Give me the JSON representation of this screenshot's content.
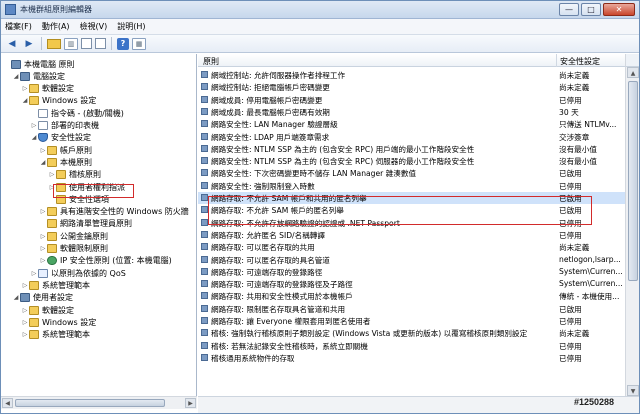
{
  "window": {
    "title": "本機群組原則編輯器",
    "min": "—",
    "max": "□",
    "close": "✕"
  },
  "menu": [
    "檔案(F)",
    "動作(A)",
    "檢視(V)",
    "說明(H)"
  ],
  "toolbar": [
    "back-icon",
    "forward-icon",
    "up-folder-icon",
    "show-tree-icon",
    "properties-icon",
    "export-icon",
    "help-icon",
    "view-icon"
  ],
  "tree": [
    {
      "label": "本機電腦 原則",
      "level": 0,
      "expander": "",
      "icon": "computer"
    },
    {
      "label": "電腦設定",
      "level": 1,
      "expander": "◢",
      "icon": "computer"
    },
    {
      "label": "軟體設定",
      "level": 2,
      "expander": "▷",
      "icon": "folder"
    },
    {
      "label": "Windows 設定",
      "level": 2,
      "expander": "◢",
      "icon": "folder"
    },
    {
      "label": "指令碼 - (啟動/關機)",
      "level": 3,
      "expander": "",
      "icon": "doc"
    },
    {
      "label": "部署的印表機",
      "level": 3,
      "expander": "▷",
      "icon": "doc"
    },
    {
      "label": "安全性設定",
      "level": 3,
      "expander": "◢",
      "icon": "shield"
    },
    {
      "label": "帳戶原則",
      "level": 4,
      "expander": "▷",
      "icon": "folder"
    },
    {
      "label": "本機原則",
      "level": 4,
      "expander": "◢",
      "icon": "folder"
    },
    {
      "label": "稽核原則",
      "level": 5,
      "expander": "▷",
      "icon": "folder"
    },
    {
      "label": "使用者權利指派",
      "level": 5,
      "expander": "▷",
      "icon": "folder"
    },
    {
      "label": "安全性選項",
      "level": 5,
      "expander": "",
      "icon": "folder"
    },
    {
      "label": "具有進階安全性的 Windows 防火牆",
      "level": 4,
      "expander": "▷",
      "icon": "folder"
    },
    {
      "label": "網路清單管理員原則",
      "level": 4,
      "expander": "",
      "icon": "folder"
    },
    {
      "label": "公開金鑰原則",
      "level": 4,
      "expander": "▷",
      "icon": "folder"
    },
    {
      "label": "軟體限制原則",
      "level": 4,
      "expander": "▷",
      "icon": "folder"
    },
    {
      "label": "IP 安全性原則 (位置: 本機電腦)",
      "level": 4,
      "expander": "▷",
      "icon": "net"
    },
    {
      "label": "以原則為依據的 QoS",
      "level": 3,
      "expander": "▷",
      "icon": "chart"
    },
    {
      "label": "系統管理範本",
      "level": 2,
      "expander": "▷",
      "icon": "folder"
    },
    {
      "label": "使用者設定",
      "level": 1,
      "expander": "◢",
      "icon": "computer"
    },
    {
      "label": "軟體設定",
      "level": 2,
      "expander": "▷",
      "icon": "folder"
    },
    {
      "label": "Windows 設定",
      "level": 2,
      "expander": "▷",
      "icon": "folder"
    },
    {
      "label": "系統管理範本",
      "level": 2,
      "expander": "▷",
      "icon": "folder"
    }
  ],
  "columns": {
    "policy": "原則",
    "setting": "安全性設定"
  },
  "policies": [
    {
      "name": "網域控制站: 允許伺服器操作者排程工作",
      "value": "尚未定義"
    },
    {
      "name": "網域控制站: 拒絕電腦帳戶密碼變更",
      "value": "尚未定義"
    },
    {
      "name": "網域成員: 停用電腦帳戶密碼變更",
      "value": "已停用"
    },
    {
      "name": "網域成員: 最長電腦帳戶密碼有效期",
      "value": "30 天"
    },
    {
      "name": "網路安全性: LAN Manager 驗證層級",
      "value": "只傳送 NTLMv..."
    },
    {
      "name": "網路安全性: LDAP 用戶端簽章需求",
      "value": "交涉簽章"
    },
    {
      "name": "網路安全性: NTLM SSP 為主的 (包含安全 RPC) 用戶端的最小工作階段安全性",
      "value": "沒有最小值"
    },
    {
      "name": "網路安全性: NTLM SSP 為主的 (包含安全 RPC) 伺服器的最小工作階段安全性",
      "value": "沒有最小值"
    },
    {
      "name": "網路安全性: 下次密碼變更時不儲存 LAN Manager 雜湊數值",
      "value": "已啟用"
    },
    {
      "name": "網路安全性: 強制限制登入時數",
      "value": "已停用"
    },
    {
      "name": "網路存取: 不允許 SAM 帳戶和共用的匿名列舉",
      "value": "已啟用"
    },
    {
      "name": "網路存取: 不允許 SAM 帳戶的匿名列舉",
      "value": "已啟用"
    },
    {
      "name": "網路存取: 不允許存放網路驗證的認證或 .NET Passport",
      "value": "已停用"
    },
    {
      "name": "網路存取: 允許匿名 SID/名稱轉譯",
      "value": "已停用"
    },
    {
      "name": "網路存取: 可以匿名存取的共用",
      "value": "尚未定義"
    },
    {
      "name": "網路存取: 可以匿名存取的具名管道",
      "value": "netlogon,lsarp..."
    },
    {
      "name": "網路存取: 可遠端存取的登錄路徑",
      "value": "System\\Curren..."
    },
    {
      "name": "網路存取: 可遠端存取的登錄路徑及子路徑",
      "value": "System\\Curren..."
    },
    {
      "name": "網路存取: 共用和安全性模式用於本機帳戶",
      "value": "傳統 - 本機使用..."
    },
    {
      "name": "網路存取: 限制匿名存取具名管道和共用",
      "value": "已啟用"
    },
    {
      "name": "網路存取: 讓 Everyone 權限套用到匿名使用者",
      "value": "已停用"
    },
    {
      "name": "稽核: 強制執行稽核原則子類別設定 (Windows Vista 或更新的版本) 以覆寫稽核原則類別設定",
      "value": "尚未定義"
    },
    {
      "name": "稽核: 若無法記錄安全性稽核時，系統立即關機",
      "value": "已停用"
    },
    {
      "name": "稽核通用系統物件的存取",
      "value": "已停用"
    }
  ],
  "badge": "#1250288"
}
